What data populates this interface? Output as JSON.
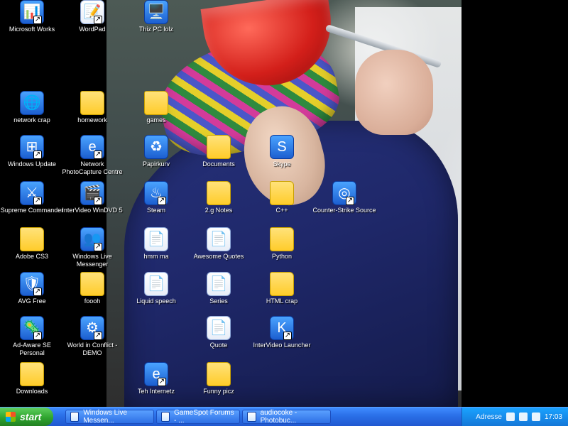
{
  "desktop": {
    "icons": [
      {
        "label": "Microsoft Works",
        "type": "app",
        "icon": "works-icon",
        "glyph": "📊"
      },
      {
        "label": "WordPad",
        "type": "doc",
        "icon": "wordpad-icon",
        "glyph": "📝"
      },
      {
        "label": "Thiz PC lolz",
        "type": "app",
        "icon": "computer-icon",
        "glyph": "🖥️"
      },
      {
        "label": "network crap",
        "type": "app",
        "icon": "network-icon",
        "glyph": "🌐"
      },
      {
        "label": "homework",
        "type": "folder",
        "icon": "folder-icon",
        "glyph": ""
      },
      {
        "label": "games",
        "type": "folder",
        "icon": "folder-icon",
        "glyph": ""
      },
      {
        "label": "Windows Update",
        "type": "app",
        "icon": "windows-update-icon",
        "glyph": "⊞"
      },
      {
        "label": "Network PhotoCapture Centre",
        "type": "app",
        "icon": "ie-shortcut-icon",
        "glyph": "e"
      },
      {
        "label": "Papirkurv",
        "type": "app",
        "icon": "recycle-bin-icon",
        "glyph": "♻"
      },
      {
        "label": "Documents",
        "type": "folder",
        "icon": "folder-icon",
        "glyph": ""
      },
      {
        "label": "Skype",
        "type": "app",
        "icon": "skype-icon",
        "glyph": "S"
      },
      {
        "label": "Supreme Commander",
        "type": "app",
        "icon": "game-icon",
        "glyph": "⚔"
      },
      {
        "label": "InterVideo WinDVD 5",
        "type": "app",
        "icon": "dvd-icon",
        "glyph": "🎬"
      },
      {
        "label": "Steam",
        "type": "app",
        "icon": "steam-icon",
        "glyph": "♨"
      },
      {
        "label": "2.g Notes",
        "type": "folder",
        "icon": "folder-icon",
        "glyph": ""
      },
      {
        "label": "C++",
        "type": "folder",
        "icon": "folder-icon",
        "glyph": ""
      },
      {
        "label": "Counter-Strike Source",
        "type": "app",
        "icon": "game-icon",
        "glyph": "◎"
      },
      {
        "label": "Adobe CS3",
        "type": "folder",
        "icon": "folder-icon",
        "glyph": ""
      },
      {
        "label": "Windows Live Messenger",
        "type": "app",
        "icon": "messenger-icon",
        "glyph": "👥"
      },
      {
        "label": "hmm ma",
        "type": "doc",
        "icon": "document-icon",
        "glyph": "📄"
      },
      {
        "label": "Awesome Quotes",
        "type": "doc",
        "icon": "document-icon",
        "glyph": "📄"
      },
      {
        "label": "Python",
        "type": "folder",
        "icon": "folder-icon",
        "glyph": ""
      },
      {
        "label": "AVG Free",
        "type": "app",
        "icon": "antivirus-icon",
        "glyph": "🛡"
      },
      {
        "label": "foooh",
        "type": "folder",
        "icon": "folder-icon",
        "glyph": ""
      },
      {
        "label": "Liquid speech",
        "type": "doc",
        "icon": "document-icon",
        "glyph": "📄"
      },
      {
        "label": "Series",
        "type": "doc",
        "icon": "document-icon",
        "glyph": "📄"
      },
      {
        "label": "HTML crap",
        "type": "folder",
        "icon": "folder-icon",
        "glyph": ""
      },
      {
        "label": "Ad-Aware SE Personal",
        "type": "app",
        "icon": "adaware-icon",
        "glyph": "🦠"
      },
      {
        "label": "World in Conflict - DEMO",
        "type": "app",
        "icon": "game-icon",
        "glyph": "⚙"
      },
      {
        "label": "Quote",
        "type": "doc",
        "icon": "document-icon",
        "glyph": "📄"
      },
      {
        "label": "InterVideo Launcher",
        "type": "app",
        "icon": "launcher-icon",
        "glyph": "K"
      },
      {
        "label": "Downloads",
        "type": "folder",
        "icon": "folder-icon",
        "glyph": ""
      },
      {
        "label": "Teh Internetz",
        "type": "app",
        "icon": "internet-explorer-icon",
        "glyph": "e"
      },
      {
        "label": "Funny picz",
        "type": "folder",
        "icon": "folder-icon",
        "glyph": ""
      }
    ]
  },
  "taskbar": {
    "start_label": "start",
    "buttons": [
      {
        "label": "Windows Live Messen...",
        "icon": "messenger-icon"
      },
      {
        "label": "GameSpot Forums - ...",
        "icon": "internet-explorer-icon"
      },
      {
        "label": "audiocoke - Photobuc...",
        "icon": "internet-explorer-icon"
      }
    ],
    "tray": {
      "address_label": "Adresse",
      "clock": "17:03"
    }
  }
}
